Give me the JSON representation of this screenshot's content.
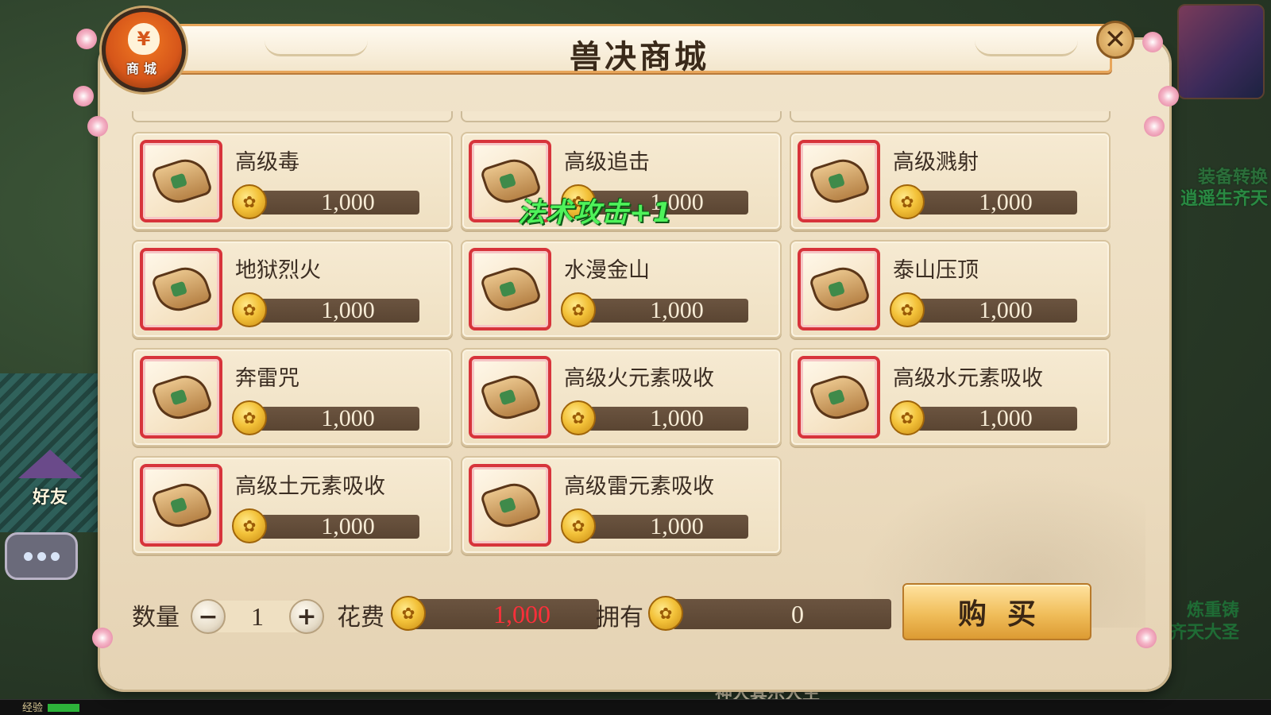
{
  "background": {
    "friend_label": "好友",
    "exp_label": "经验",
    "right_texts": [
      "装备转换",
      "逍遥生齐天",
      "炼重铸",
      "齐天大圣"
    ],
    "bottom_text": "神人其乐人生"
  },
  "panel": {
    "title": "兽决商城",
    "emblem_label": "商城",
    "emblem_symbol": "¥",
    "close_symbol": "✕"
  },
  "items": [
    {
      "name": "高级毒",
      "price": "1,000"
    },
    {
      "name": "高级追击",
      "price": "1,000"
    },
    {
      "name": "高级溅射",
      "price": "1,000"
    },
    {
      "name": "地狱烈火",
      "price": "1,000"
    },
    {
      "name": "水漫金山",
      "price": "1,000"
    },
    {
      "name": "泰山压顶",
      "price": "1,000"
    },
    {
      "name": "奔雷咒",
      "price": "1,000"
    },
    {
      "name": "高级火元素吸收",
      "price": "1,000"
    },
    {
      "name": "高级水元素吸收",
      "price": "1,000"
    },
    {
      "name": "高级土元素吸收",
      "price": "1,000"
    },
    {
      "name": "高级雷元素吸收",
      "price": "1,000"
    }
  ],
  "floating_text": "法术攻击+1",
  "controls": {
    "quantity_label": "数量",
    "quantity_value": "1",
    "minus_symbol": "−",
    "plus_symbol": "+",
    "cost_label": "花费",
    "cost_value": "1,000",
    "own_label": "拥有",
    "own_value": "0",
    "buy_label": "购买"
  },
  "colors": {
    "cost_text": "#ff2f3a",
    "icon_border": "#d7343b",
    "panel_bg": "#f1e4cb",
    "float_text": "#4ef25a"
  },
  "icons": {
    "item_icon": "scroll-icon",
    "currency": "gold-coin-icon"
  }
}
